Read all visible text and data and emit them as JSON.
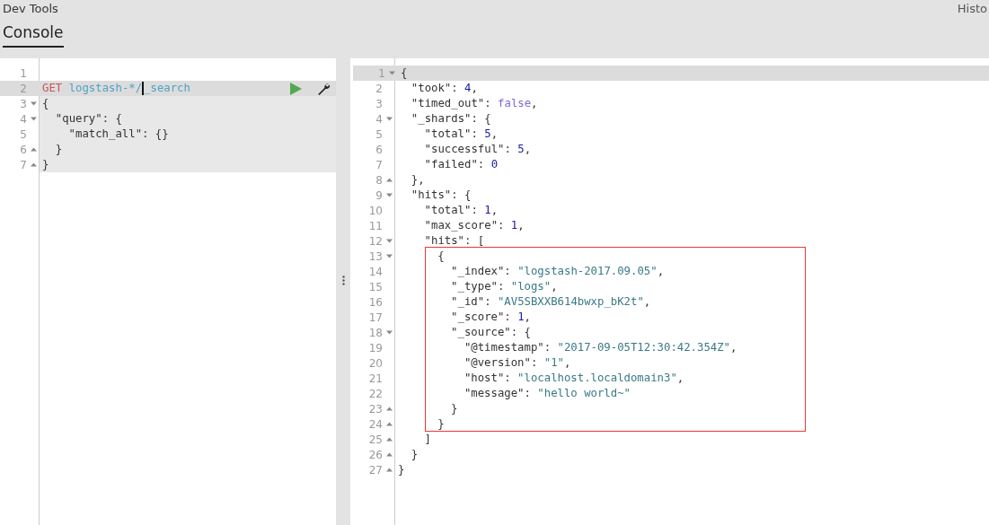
{
  "app": {
    "title": "Dev Tools",
    "history_link": "Histo"
  },
  "tabs": [
    {
      "label": "Console",
      "selected": true
    }
  ],
  "request_editor": {
    "lines": [
      {
        "number": "1",
        "active": false,
        "in_request": false,
        "fold_start": false,
        "fold_end": false,
        "actions": false
      },
      {
        "number": "2",
        "active": true,
        "in_request": true,
        "fold_start": false,
        "fold_end": false,
        "actions": true,
        "tokens": [
          {
            "kind": "method",
            "text": "GET"
          },
          {
            "kind": "url",
            "text": "logstash-*/",
            "cursor_after": true
          },
          {
            "kind": "url",
            "text": "_search",
            "cursor_after": false
          }
        ]
      },
      {
        "number": "3",
        "active": false,
        "in_request": true,
        "fold_start": true,
        "fold_end": false,
        "actions": false,
        "tokens": [
          {
            "kind": "punct",
            "text": "{"
          }
        ]
      },
      {
        "number": "4",
        "active": false,
        "in_request": true,
        "fold_start": true,
        "fold_end": false,
        "actions": false,
        "tokens": [
          {
            "kind": "key",
            "text": "\"query\""
          },
          {
            "kind": "punct",
            "text": ": {"
          }
        ]
      },
      {
        "number": "5",
        "active": false,
        "in_request": true,
        "fold_start": false,
        "fold_end": false,
        "actions": false,
        "tokens": [
          {
            "kind": "key",
            "text": "\"match_all\""
          },
          {
            "kind": "punct",
            "text": ": {}"
          }
        ]
      },
      {
        "number": "6",
        "active": false,
        "in_request": true,
        "fold_start": false,
        "fold_end": true,
        "actions": false,
        "tokens": [
          {
            "kind": "punct",
            "text": "}"
          }
        ]
      },
      {
        "number": "7",
        "active": false,
        "in_request": true,
        "fold_start": false,
        "fold_end": true,
        "actions": false,
        "tokens": [
          {
            "kind": "punct",
            "text": "}"
          }
        ]
      }
    ]
  },
  "response_editor": {
    "lines": [
      {
        "number": "1",
        "active": true,
        "fold_start": true,
        "fold_end": false,
        "boxed": false,
        "tokens": [
          {
            "kind": "punct",
            "text": "{"
          }
        ]
      },
      {
        "number": "2",
        "active": false,
        "fold_start": false,
        "fold_end": false,
        "boxed": false,
        "tokens": [
          {
            "kind": "key",
            "text": "\"took\""
          },
          {
            "kind": "punct",
            "text": ": "
          },
          {
            "kind": "number",
            "text": "4"
          },
          {
            "kind": "punct",
            "text": ","
          }
        ]
      },
      {
        "number": "3",
        "active": false,
        "fold_start": false,
        "fold_end": false,
        "boxed": false,
        "tokens": [
          {
            "kind": "key",
            "text": "\"timed_out\""
          },
          {
            "kind": "punct",
            "text": ": "
          },
          {
            "kind": "bool",
            "text": "false"
          },
          {
            "kind": "punct",
            "text": ","
          }
        ]
      },
      {
        "number": "4",
        "active": false,
        "fold_start": true,
        "fold_end": false,
        "boxed": false,
        "tokens": [
          {
            "kind": "key",
            "text": "\"_shards\""
          },
          {
            "kind": "punct",
            "text": ": {"
          }
        ]
      },
      {
        "number": "5",
        "active": false,
        "fold_start": false,
        "fold_end": false,
        "boxed": false,
        "tokens": [
          {
            "kind": "key",
            "text": "\"total\""
          },
          {
            "kind": "punct",
            "text": ": "
          },
          {
            "kind": "number",
            "text": "5"
          },
          {
            "kind": "punct",
            "text": ","
          }
        ]
      },
      {
        "number": "6",
        "active": false,
        "fold_start": false,
        "fold_end": false,
        "boxed": false,
        "tokens": [
          {
            "kind": "key",
            "text": "\"successful\""
          },
          {
            "kind": "punct",
            "text": ": "
          },
          {
            "kind": "number",
            "text": "5"
          },
          {
            "kind": "punct",
            "text": ","
          }
        ]
      },
      {
        "number": "7",
        "active": false,
        "fold_start": false,
        "fold_end": false,
        "boxed": false,
        "tokens": [
          {
            "kind": "key",
            "text": "\"failed\""
          },
          {
            "kind": "punct",
            "text": ": "
          },
          {
            "kind": "number",
            "text": "0"
          }
        ]
      },
      {
        "number": "8",
        "active": false,
        "fold_start": false,
        "fold_end": true,
        "boxed": false,
        "tokens": [
          {
            "kind": "punct",
            "text": "},"
          }
        ]
      },
      {
        "number": "9",
        "active": false,
        "fold_start": true,
        "fold_end": false,
        "boxed": false,
        "tokens": [
          {
            "kind": "key",
            "text": "\"hits\""
          },
          {
            "kind": "punct",
            "text": ": {"
          }
        ]
      },
      {
        "number": "10",
        "active": false,
        "fold_start": false,
        "fold_end": false,
        "boxed": false,
        "tokens": [
          {
            "kind": "key",
            "text": "\"total\""
          },
          {
            "kind": "punct",
            "text": ": "
          },
          {
            "kind": "number",
            "text": "1"
          },
          {
            "kind": "punct",
            "text": ","
          }
        ]
      },
      {
        "number": "11",
        "active": false,
        "fold_start": false,
        "fold_end": false,
        "boxed": false,
        "tokens": [
          {
            "kind": "key",
            "text": "\"max_score\""
          },
          {
            "kind": "punct",
            "text": ": "
          },
          {
            "kind": "number",
            "text": "1"
          },
          {
            "kind": "punct",
            "text": ","
          }
        ]
      },
      {
        "number": "12",
        "active": false,
        "fold_start": true,
        "fold_end": false,
        "boxed": false,
        "tokens": [
          {
            "kind": "key",
            "text": "\"hits\""
          },
          {
            "kind": "punct",
            "text": ": ["
          }
        ]
      },
      {
        "number": "13",
        "active": false,
        "fold_start": true,
        "fold_end": false,
        "boxed": true,
        "tokens": [
          {
            "kind": "punct",
            "text": "{"
          }
        ]
      },
      {
        "number": "14",
        "active": false,
        "fold_start": false,
        "fold_end": false,
        "boxed": true,
        "tokens": [
          {
            "kind": "key",
            "text": "\"_index\""
          },
          {
            "kind": "punct",
            "text": ": "
          },
          {
            "kind": "string",
            "text": "\"logstash-2017.09.05\""
          },
          {
            "kind": "punct",
            "text": ","
          }
        ]
      },
      {
        "number": "15",
        "active": false,
        "fold_start": false,
        "fold_end": false,
        "boxed": true,
        "tokens": [
          {
            "kind": "key",
            "text": "\"_type\""
          },
          {
            "kind": "punct",
            "text": ": "
          },
          {
            "kind": "string",
            "text": "\"logs\""
          },
          {
            "kind": "punct",
            "text": ","
          }
        ]
      },
      {
        "number": "16",
        "active": false,
        "fold_start": false,
        "fold_end": false,
        "boxed": true,
        "tokens": [
          {
            "kind": "key",
            "text": "\"_id\""
          },
          {
            "kind": "punct",
            "text": ": "
          },
          {
            "kind": "string",
            "text": "\"AV5SBXXB614bwxp_bK2t\""
          },
          {
            "kind": "punct",
            "text": ","
          }
        ]
      },
      {
        "number": "17",
        "active": false,
        "fold_start": false,
        "fold_end": false,
        "boxed": true,
        "tokens": [
          {
            "kind": "key",
            "text": "\"_score\""
          },
          {
            "kind": "punct",
            "text": ": "
          },
          {
            "kind": "number",
            "text": "1"
          },
          {
            "kind": "punct",
            "text": ","
          }
        ]
      },
      {
        "number": "18",
        "active": false,
        "fold_start": true,
        "fold_end": false,
        "boxed": true,
        "tokens": [
          {
            "kind": "key",
            "text": "\"_source\""
          },
          {
            "kind": "punct",
            "text": ": {"
          }
        ]
      },
      {
        "number": "19",
        "active": false,
        "fold_start": false,
        "fold_end": false,
        "boxed": true,
        "tokens": [
          {
            "kind": "key",
            "text": "\"@timestamp\""
          },
          {
            "kind": "punct",
            "text": ": "
          },
          {
            "kind": "string",
            "text": "\"2017-09-05T12:30:42.354Z\""
          },
          {
            "kind": "punct",
            "text": ","
          }
        ]
      },
      {
        "number": "20",
        "active": false,
        "fold_start": false,
        "fold_end": false,
        "boxed": true,
        "tokens": [
          {
            "kind": "key",
            "text": "\"@version\""
          },
          {
            "kind": "punct",
            "text": ": "
          },
          {
            "kind": "string",
            "text": "\"1\""
          },
          {
            "kind": "punct",
            "text": ","
          }
        ]
      },
      {
        "number": "21",
        "active": false,
        "fold_start": false,
        "fold_end": false,
        "boxed": true,
        "tokens": [
          {
            "kind": "key",
            "text": "\"host\""
          },
          {
            "kind": "punct",
            "text": ": "
          },
          {
            "kind": "string",
            "text": "\"localhost.localdomain3\""
          },
          {
            "kind": "punct",
            "text": ","
          }
        ]
      },
      {
        "number": "22",
        "active": false,
        "fold_start": false,
        "fold_end": false,
        "boxed": true,
        "tokens": [
          {
            "kind": "key",
            "text": "\"message\""
          },
          {
            "kind": "punct",
            "text": ": "
          },
          {
            "kind": "string",
            "text": "\"hello world~\""
          }
        ]
      },
      {
        "number": "23",
        "active": false,
        "fold_start": false,
        "fold_end": true,
        "boxed": true,
        "tokens": [
          {
            "kind": "punct",
            "text": "}"
          }
        ]
      },
      {
        "number": "24",
        "active": false,
        "fold_start": false,
        "fold_end": true,
        "boxed": true,
        "tokens": [
          {
            "kind": "punct",
            "text": "}"
          }
        ]
      },
      {
        "number": "25",
        "active": false,
        "fold_start": false,
        "fold_end": true,
        "boxed": false,
        "tokens": [
          {
            "kind": "punct",
            "text": "]"
          }
        ]
      },
      {
        "number": "26",
        "active": false,
        "fold_start": false,
        "fold_end": true,
        "boxed": false,
        "tokens": [
          {
            "kind": "punct",
            "text": "}"
          }
        ]
      },
      {
        "number": "27",
        "active": false,
        "fold_start": false,
        "fold_end": true,
        "boxed": false,
        "tokens": [
          {
            "kind": "punct",
            "text": "}"
          }
        ]
      }
    ]
  }
}
